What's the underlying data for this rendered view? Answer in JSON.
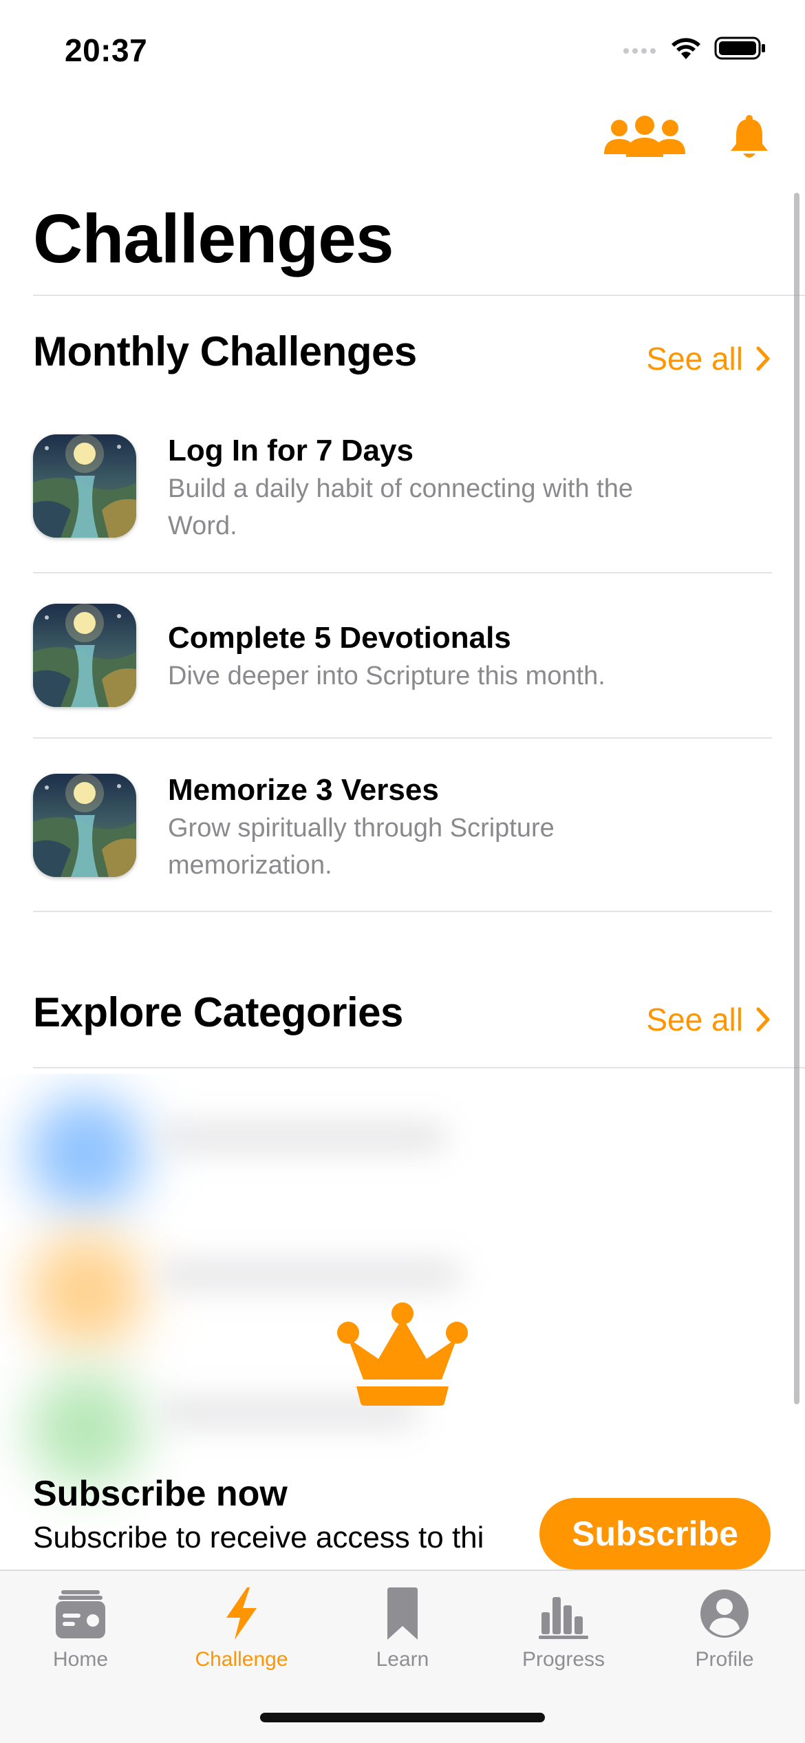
{
  "status_bar": {
    "time": "20:37"
  },
  "header": {
    "title": "Challenges"
  },
  "monthly": {
    "title": "Monthly Challenges",
    "see_all": "See all",
    "items": [
      {
        "title": "Log In for 7 Days",
        "description": "Build a daily habit of connecting with the Word."
      },
      {
        "title": "Complete 5 Devotionals",
        "description": "Dive deeper into Scripture this month."
      },
      {
        "title": "Memorize 3 Verses",
        "description": "Grow spiritually through Scripture memorization."
      }
    ]
  },
  "explore": {
    "title": "Explore Categories",
    "see_all": "See all"
  },
  "subscribe": {
    "title": "Subscribe now",
    "description": "Subscribe to receive access to thi",
    "button_label": "Subscribe"
  },
  "tabs": [
    {
      "label": "Home",
      "icon": "home-card-icon"
    },
    {
      "label": "Challenge",
      "icon": "bolt-icon",
      "active": true
    },
    {
      "label": "Learn",
      "icon": "bookmark-icon"
    },
    {
      "label": "Progress",
      "icon": "bar-chart-icon"
    },
    {
      "label": "Profile",
      "icon": "person-circle-icon"
    }
  ],
  "colors": {
    "accent": "#ff9500",
    "secondary_text": "#8a8a8e",
    "divider": "#e3e3e5",
    "tab_inactive": "#8e8e93"
  }
}
